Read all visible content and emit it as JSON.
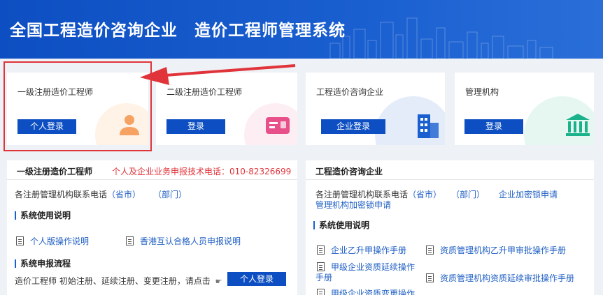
{
  "header": {
    "title": "全国工程造价咨询企业　造价工程师管理系统"
  },
  "cards": [
    {
      "name": "一级注册造价工程师",
      "button": "个人登录",
      "icon": "person-icon",
      "accent": "#f5a262"
    },
    {
      "name": "二级注册造价工程师",
      "button": "登录",
      "icon": "id-card-icon",
      "accent": "#e8508a"
    },
    {
      "name": "工程造价咨询企业",
      "button": "企业登录",
      "icon": "building-icon",
      "accent": "#1a5fd0"
    },
    {
      "name": "管理机构",
      "button": "登录",
      "icon": "institution-icon",
      "accent": "#19b28a"
    }
  ],
  "left_panel": {
    "title": "一级注册造价工程师",
    "hotline": "个人及企业业务申报技术电话：010-82326699",
    "contact_label": "各注册管理机构联系电话",
    "contact_links": [
      "（省市）",
      "（部门）"
    ],
    "usage_title": "系统使用说明",
    "docs": [
      "个人版操作说明",
      "香港互认合格人员申报说明"
    ],
    "flow_title": "系统申报流程",
    "flow_text": "造价工程师 初始注册、延续注册、变更注册，请点击",
    "flow_button": "个人登录"
  },
  "right_panel": {
    "title": "工程造价咨询企业",
    "contact_label": "各注册管理机构联系电话",
    "contact_links": [
      "（省市）",
      "（部门）",
      "企业加密锁申请"
    ],
    "contact_link2": "管理机构加密锁申请",
    "usage_title": "系统使用说明",
    "docs": [
      "企业乙升甲操作手册",
      "资质管理机构乙升甲审批操作手册",
      "甲级企业资质延续操作",
      "手册",
      "资质管理机构资质延续审批操作手册",
      "甲级企业资质变更操作"
    ]
  }
}
